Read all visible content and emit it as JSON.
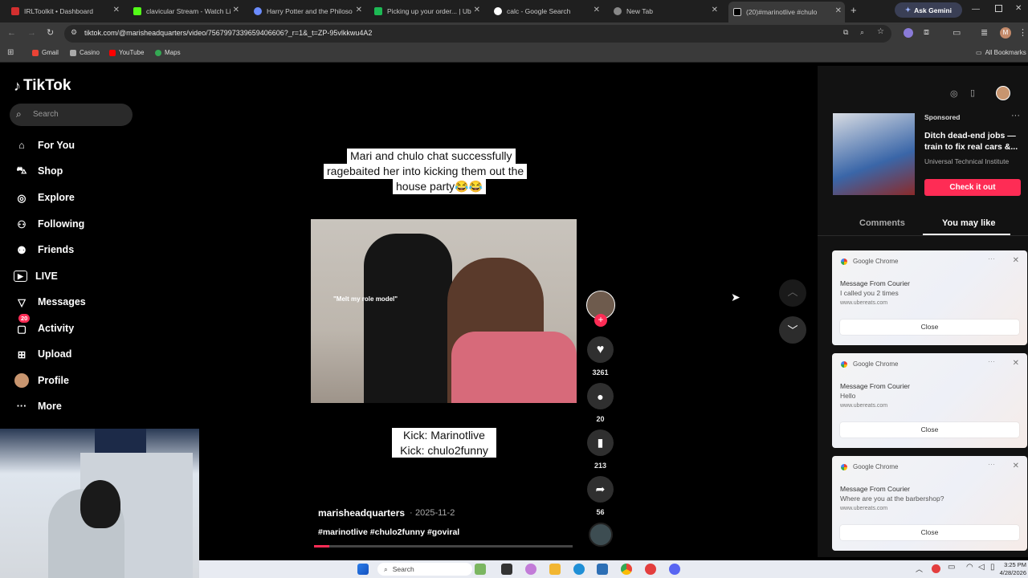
{
  "browser": {
    "tabs": [
      {
        "title": "IRLToolkit • Dashboard",
        "color": "#d32f2f"
      },
      {
        "title": "clavicular Stream - Watch Li",
        "color": "#53fc18"
      },
      {
        "title": "Harry Potter and the Philoso",
        "color": "#6b8cff"
      },
      {
        "title": "Picking up your order... | Ub",
        "color": "#1db954"
      },
      {
        "title": "calc - Google Search",
        "color": "#ffffff"
      },
      {
        "title": "New Tab",
        "color": "#aaaaaa"
      },
      {
        "title": "(20)#marinotlive #chulo",
        "color": "#000000"
      }
    ],
    "ask_gemini": "Ask Gemini",
    "url": "tiktok.com/@marisheadquarters/video/7567997339659406606?_r=1&_t=ZP-95vlkkwu4A2",
    "bookmarks": [
      "Gmail",
      "Casino",
      "YouTube",
      "Maps"
    ],
    "all_bookmarks": "All Bookmarks"
  },
  "tiktok": {
    "logo": "TikTok",
    "search_placeholder": "Search",
    "nav": [
      {
        "label": "For You",
        "icon": "home-icon"
      },
      {
        "label": "Shop",
        "icon": "shopping-bag-icon"
      },
      {
        "label": "Explore",
        "icon": "compass-icon"
      },
      {
        "label": "Following",
        "icon": "following-icon"
      },
      {
        "label": "Friends",
        "icon": "friends-icon"
      },
      {
        "label": "LIVE",
        "icon": "live-icon"
      },
      {
        "label": "Messages",
        "icon": "messages-icon"
      },
      {
        "label": "Activity",
        "icon": "activity-icon"
      },
      {
        "label": "Upload",
        "icon": "upload-icon"
      },
      {
        "label": "Profile",
        "icon": "avatar"
      },
      {
        "label": "More",
        "icon": "more-icon"
      }
    ],
    "activity_badge": "20"
  },
  "video": {
    "caption_top": [
      "Mari and chulo chat successfully",
      "ragebaited her into kicking them out the",
      "house party😂😂"
    ],
    "caption_bottom": [
      "Kick: Marinotlive",
      "Kick: chulo2funny"
    ],
    "inner_caption": "\"Melt my role model\"",
    "author": "marisheadquarters",
    "date": "2025-11-2",
    "hashtags": "#marinotlive #chulo2funny #goviral",
    "progress": 0.06,
    "likes": "3261",
    "comments": "20",
    "saves": "213",
    "shares": "56"
  },
  "right_panel": {
    "sponsored": "Sponsored",
    "ad_title": "Ditch dead-end jobs — train to fix real cars &...",
    "ad_company": "Universal Technical Institute",
    "cta": "Check it out",
    "tabs": [
      "Comments",
      "You may like"
    ]
  },
  "notifications": [
    {
      "app": "Google Chrome",
      "title": "Message From Courier",
      "body": "I called you 2 times",
      "site": "www.ubereats.com",
      "close": "Close"
    },
    {
      "app": "Google Chrome",
      "title": "Message From Courier",
      "body": "Hello",
      "site": "www.ubereats.com",
      "close": "Close"
    },
    {
      "app": "Google Chrome",
      "title": "Message From Courier",
      "body": "Where are you at the barbershop?",
      "site": "www.ubereats.com",
      "close": "Close"
    }
  ],
  "taskbar": {
    "search": "Search",
    "time": "3:25 PM",
    "date": "4/28/2026"
  },
  "colors": {
    "accent": "#fe2c55",
    "tab_bg": "#1f1f1f",
    "toolbar_bg": "#3a3a3a"
  }
}
